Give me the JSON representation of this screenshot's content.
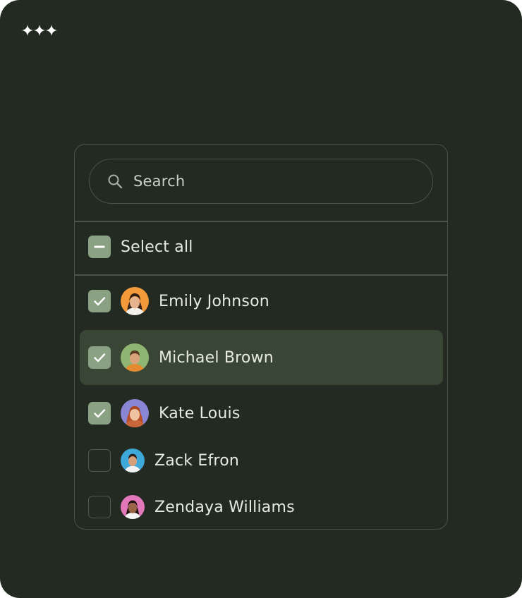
{
  "search": {
    "placeholder": "Search"
  },
  "select_all": {
    "label": "Select all",
    "state": "indeterminate"
  },
  "people": [
    {
      "name": "Emily Johnson",
      "checked": true,
      "avatar_color": "#f39a3a"
    },
    {
      "name": "Michael Brown",
      "checked": true,
      "highlighted": true,
      "avatar_color": "#8fb573"
    },
    {
      "name": "Kate Louis",
      "checked": true,
      "avatar_color": "#8a86d6"
    },
    {
      "name": "Zack Efron",
      "checked": false,
      "avatar_color": "#3ea8d8"
    },
    {
      "name": "Zendaya Williams",
      "checked": false,
      "avatar_color": "#e277b9"
    }
  ],
  "colors": {
    "background": "#222a21",
    "checkbox": "#8aa283",
    "highlight": "#394636",
    "border": "#4a5446"
  }
}
